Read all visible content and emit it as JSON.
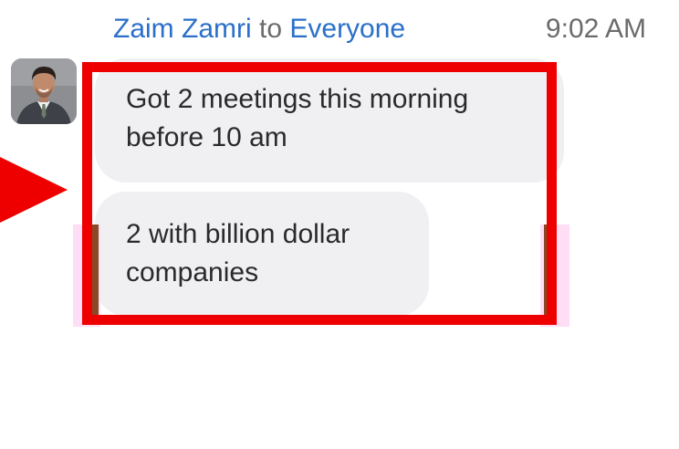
{
  "header": {
    "sender_name": "Zaim Zamri",
    "to_word": "to",
    "recipient": "Everyone",
    "time": "9:02 AM"
  },
  "messages": [
    {
      "text": "Got 2 meetings this morning before 10 am"
    },
    {
      "text": "2 with billion dollar companies"
    }
  ],
  "colors": {
    "name_link": "#2a6fc9",
    "meta_gray": "#6b6b6b",
    "bubble_bg": "#f0f0f3",
    "annotation_red": "#ee0000"
  },
  "icons": {
    "avatar": "user-avatar-photo",
    "pointer": "red-arrow-annotation"
  }
}
